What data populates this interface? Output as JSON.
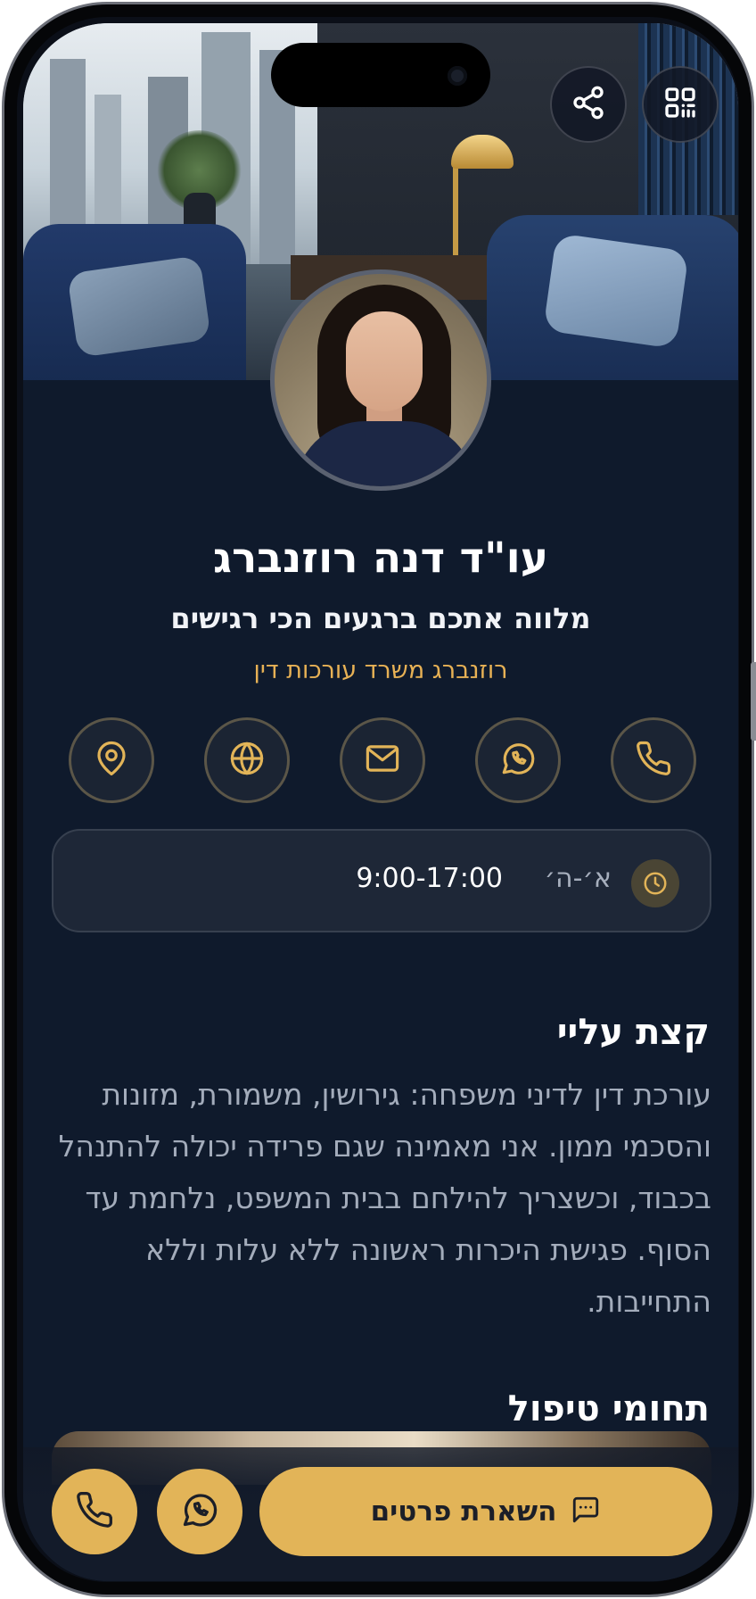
{
  "header": {
    "share_icon": "share-icon",
    "qr_icon": "qr-code-icon"
  },
  "profile": {
    "name": "עו\"ד דנה רוזנברג",
    "tagline": "מלווה אתכם ברגעים הכי רגישים",
    "firm": "רוזנברג משרד עורכות דין"
  },
  "actions": [
    {
      "icon": "phone-icon"
    },
    {
      "icon": "whatsapp-icon"
    },
    {
      "icon": "mail-icon"
    },
    {
      "icon": "globe-icon"
    },
    {
      "icon": "location-pin-icon"
    }
  ],
  "hours": {
    "days": "א׳-ה׳",
    "time": "9:00-17:00"
  },
  "about": {
    "title": "קצת עליי",
    "text": "עורכת דין לדיני משפחה: גירושין, משמורת, מזונות והסכמי ממון. אני מאמינה שגם פרידה יכולה להתנהל בכבוד, וכשצריך להילחם בבית המשפט, נלחמת עד הסוף. פגישת היכרות ראשונה ללא עלות וללא התחייבות."
  },
  "areas": {
    "title": "תחומי טיפול"
  },
  "bottom_bar": {
    "cta_label": "השארת פרטים"
  },
  "colors": {
    "accent": "#e2b458",
    "background": "#0f1a2c",
    "card": "#1e2737"
  }
}
